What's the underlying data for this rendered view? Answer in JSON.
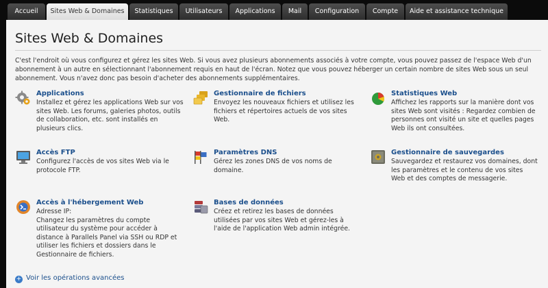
{
  "tabs": [
    {
      "label": "Accueil"
    },
    {
      "label": "Sites Web & Domaines",
      "active": true
    },
    {
      "label": "Statistiques"
    },
    {
      "label": "Utilisateurs"
    },
    {
      "label": "Applications"
    },
    {
      "label": "Mail"
    },
    {
      "label": "Configuration"
    },
    {
      "label": "Compte"
    },
    {
      "label": "Aide et assistance technique"
    }
  ],
  "page": {
    "title": "Sites Web & Domaines",
    "intro": "C'est l'endroit où vous configurez et gérez les sites Web. Si vous avez plusieurs abonnements associés à votre compte, vous pouvez passez de l'espace Web d'un abonnement à un autre en sélectionnant l'abonnement requis en haut de l'écran. Notez que vous pouvez héberger un certain nombre de sites Web sous un seul abonnement. Vous n'avez donc pas besoin d'acheter des abonnements supplémentaires."
  },
  "items": [
    {
      "title": "Applications",
      "desc": "Installez et gérez les applications Web sur vos sites Web. Les forums, galeries photos, outils de collaboration, etc. sont installés en plusieurs clics.",
      "icon": "gear-icon"
    },
    {
      "title": "Gestionnaire de fichiers",
      "desc": "Envoyez les nouveaux fichiers et utilisez les fichiers et répertoires actuels de vos sites Web.",
      "icon": "folders-icon"
    },
    {
      "title": "Statistiques Web",
      "desc": "Affichez les rapports sur la manière dont vos sites Web sont visités : Regardez combien de personnes ont visité un site et quelles pages Web ils ont consultées.",
      "icon": "pie-chart-icon"
    },
    {
      "title": "Accès FTP",
      "desc": "Configurez l'accès de vos sites Web via le protocole FTP.",
      "icon": "monitor-icon"
    },
    {
      "title": "Paramètres DNS",
      "desc": "Gérez les zones DNS de vos noms de domaine.",
      "icon": "flags-icon"
    },
    {
      "title": "Gestionnaire de sauvegardes",
      "desc": "Sauvegardez et restaurez vos domaines, dont les paramètres et le contenu de vos sites Web et des comptes de messagerie.",
      "icon": "safe-icon"
    },
    {
      "title": "Accès à l'hébergement Web",
      "desc": "Adresse IP:\nChangez les paramètres du compte utilisateur du système pour accéder à distance à Parallels Panel via SSH ou RDP et utiliser les fichiers et dossiers dans le Gestionnaire de fichiers.",
      "icon": "shell-icon"
    },
    {
      "title": "Bases de données",
      "desc": "Créez et retirez les bases de données utilisées par vos sites Web et gérez-les à l'aide de l'application Web admin intégrée.",
      "icon": "database-icon"
    }
  ],
  "advanced_link": "Voir les opérations avancées"
}
